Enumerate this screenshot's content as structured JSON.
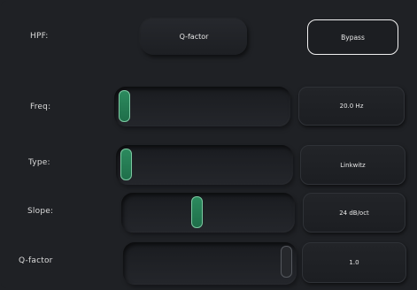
{
  "hpf": {
    "label": "HPF:",
    "qfactor_button": "Q-factor",
    "bypass_button": "Bypass"
  },
  "controls": [
    {
      "label": "Freq:",
      "value": "20.0 Hz",
      "thumb_level": 0.0,
      "thumb_active": true
    },
    {
      "label": "Type:",
      "value": "Linkwitz",
      "thumb_level": 0.0,
      "thumb_active": true
    },
    {
      "label": "Slope:",
      "value": "24 dB/oct",
      "thumb_level": 0.43,
      "thumb_active": true
    },
    {
      "label": "Q-factor",
      "value": "1.0",
      "thumb_level": 1.0,
      "thumb_active": false
    }
  ],
  "colors": {
    "background": "#1f2125",
    "thumb_active": "#237a52",
    "thumb_active_border": "#7cc9a2",
    "bypass_border": "#f2f2f2"
  }
}
